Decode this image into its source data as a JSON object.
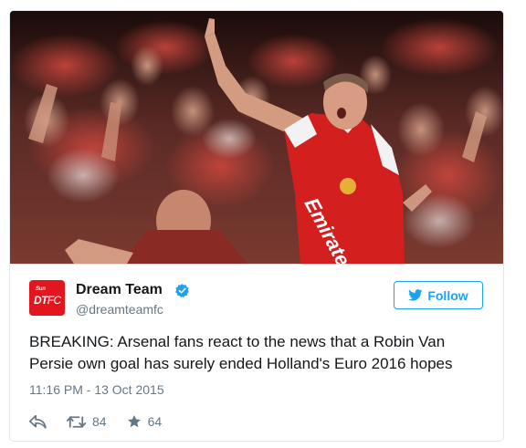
{
  "media": {
    "kind": "photo",
    "subject": "arsenal-fans-cheering"
  },
  "author": {
    "avatar_small": "Sun",
    "avatar_main_bold": "DT",
    "avatar_main_light": "FC",
    "name": "Dream Team",
    "handle": "@dreamteamfc",
    "verified": true
  },
  "follow_button": {
    "label": "Follow"
  },
  "tweet": {
    "text": "BREAKING: Arsenal fans react to the news that a Robin Van Persie own goal has surely ended Holland's Euro 2016 hopes",
    "timestamp": "11:16 PM - 13 Oct 2015"
  },
  "actions": {
    "retweet_count": "84",
    "like_count": "64"
  },
  "icons": {
    "reply": "reply-icon",
    "retweet": "retweet-icon",
    "like": "star-icon",
    "verified": "verified-badge-icon",
    "follow": "twitter-bird-icon"
  },
  "colors": {
    "twitter_blue": "#1da1f2",
    "text_primary": "#14171a",
    "text_secondary": "#657786",
    "avatar_red": "#e3161f",
    "border": "#e1e8ed"
  }
}
